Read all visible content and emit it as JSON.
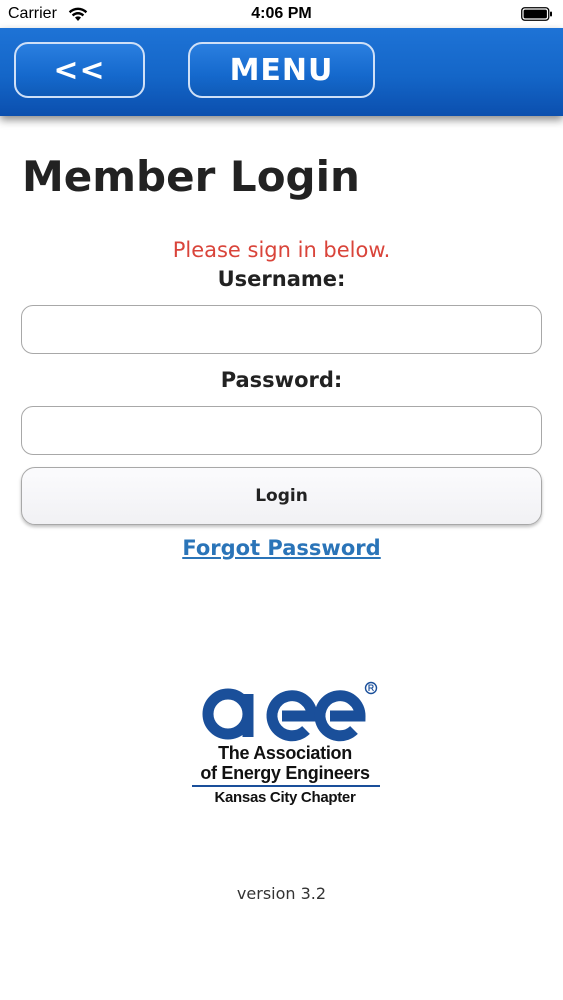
{
  "status_bar": {
    "carrier": "Carrier",
    "time": "4:06 PM",
    "wifi_icon": "wifi-icon",
    "battery_icon": "battery-icon"
  },
  "nav": {
    "back_label": "<<",
    "menu_label": "MENU",
    "bar_color": "#1466c8"
  },
  "login": {
    "title": "Member Login",
    "message": "Please sign in below.",
    "message_color": "#d9443a",
    "username_label": "Username:",
    "username_value": "",
    "password_label": "Password:",
    "password_value": "",
    "login_button": "Login",
    "forgot_link": "Forgot Password",
    "link_color": "#2a74b8"
  },
  "logo": {
    "mark": "aee",
    "line1": "The Association",
    "line2": "of Energy Engineers",
    "line3": "Kansas City Chapter",
    "brand_color": "#1a4f9a"
  },
  "footer": {
    "version": "version 3.2"
  }
}
